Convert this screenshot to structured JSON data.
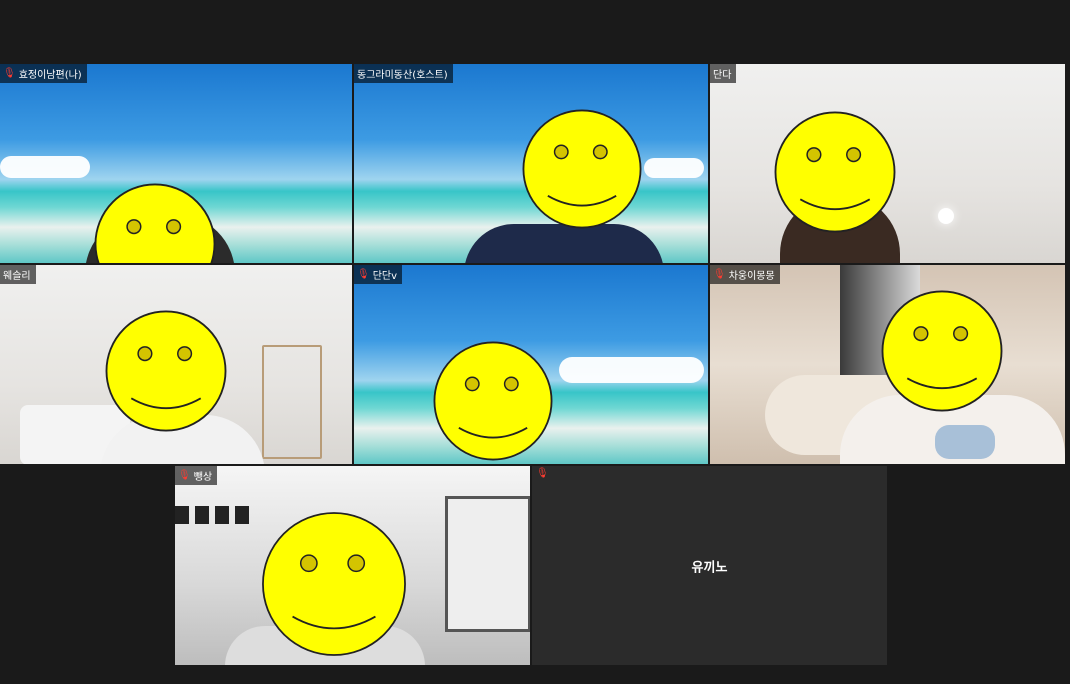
{
  "participants": [
    {
      "name": "효정이남편(나)",
      "muted": true
    },
    {
      "name": "동그라미동산(호스트)",
      "muted": false,
      "active_speaker": true
    },
    {
      "name": "단다",
      "muted": false
    },
    {
      "name": "웨슬리",
      "muted": false
    },
    {
      "name": "단단v",
      "muted": true
    },
    {
      "name": "차웅이몽몽",
      "muted": true
    },
    {
      "name": "뺑상",
      "muted": true
    },
    {
      "name": "유끼노",
      "muted": true,
      "video_off": true
    }
  ],
  "colors": {
    "active_speaker_border": "#22d36b",
    "muted_icon": "#ff3b30",
    "smiley_fill": "#ffff00",
    "background": "#1a1a1a"
  },
  "icons": {
    "muted": "microphone-muted-icon",
    "face_cover": "smiley-face-icon"
  }
}
